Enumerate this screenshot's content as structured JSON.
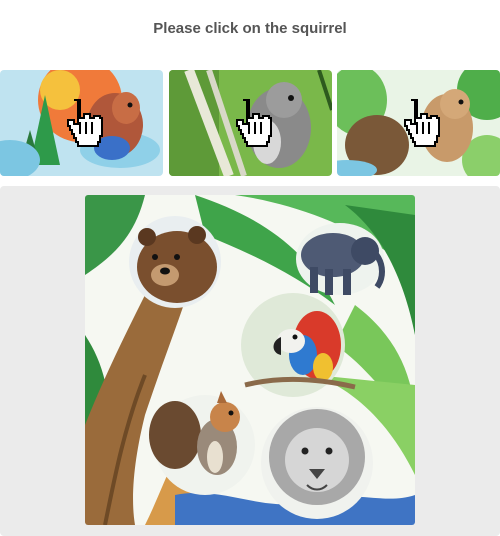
{
  "prompt": {
    "text": "Please click on the squirrel"
  },
  "examples": [
    {
      "subject": "squirrel",
      "style": "colorful watercolor",
      "cursor": "pointer-hand-icon"
    },
    {
      "subject": "squirrel",
      "style": "grey pencil sketch",
      "cursor": "pointer-hand-icon"
    },
    {
      "subject": "squirrel",
      "style": "green watercolor",
      "cursor": "pointer-hand-icon"
    }
  ],
  "challenge": {
    "animals": [
      "bear",
      "elephant",
      "parrot",
      "squirrel",
      "lion"
    ],
    "target": "squirrel"
  },
  "colors": {
    "panel_bg": "#ebebeb",
    "title_text": "#555555",
    "leaf_green": "#3fa44a",
    "trunk_brown": "#9a6b3b"
  }
}
